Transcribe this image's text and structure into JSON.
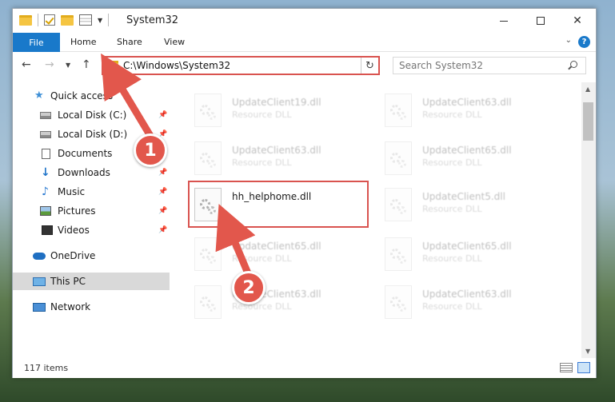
{
  "window": {
    "title": "System32",
    "controls": {
      "minimize": "",
      "maximize": "",
      "close": "✕"
    }
  },
  "ribbon": {
    "file_label": "File",
    "tabs": [
      "Home",
      "Share",
      "View"
    ],
    "expand": "⌄",
    "help": "?"
  },
  "navbar": {
    "back": "←",
    "forward": "→",
    "recent": "▼",
    "up": "↑",
    "address": "C:\\Windows\\System32",
    "refresh": "↻",
    "search_placeholder": "Search System32"
  },
  "sidebar": {
    "items": [
      {
        "label": "Quick access",
        "icon": "star-icon"
      },
      {
        "label": "Local Disk (C:)",
        "icon": "disk-icon",
        "pinned": "📌"
      },
      {
        "label": "Local Disk (D:)",
        "icon": "disk-icon",
        "pinned": "📌"
      },
      {
        "label": "Documents",
        "icon": "documents-icon",
        "pinned": "📌"
      },
      {
        "label": "Downloads",
        "icon": "downloads-icon",
        "pinned": "📌"
      },
      {
        "label": "Music",
        "icon": "music-icon",
        "pinned": "📌"
      },
      {
        "label": "Pictures",
        "icon": "pictures-icon",
        "pinned": "📌"
      },
      {
        "label": "Videos",
        "icon": "videos-icon",
        "pinned": "📌"
      },
      {
        "label": "OneDrive",
        "icon": "onedrive-icon"
      },
      {
        "label": "This PC",
        "icon": "this-pc-icon"
      },
      {
        "label": "Network",
        "icon": "network-icon"
      }
    ]
  },
  "files": [
    {
      "name": "UpdateClient19.dll",
      "type": "Resource DLL"
    },
    {
      "name": "UpdateClient63.dll",
      "type": "Resource DLL"
    },
    {
      "name": "UpdateClient63.dll",
      "type": "Resource DLL"
    },
    {
      "name": "UpdateClient65.dll",
      "type": "Resource DLL"
    },
    {
      "name": "hh_helphome.dll",
      "type": ""
    },
    {
      "name": "UpdateClient5.dll",
      "type": "Resource DLL"
    },
    {
      "name": "UpdateClient65.dll",
      "type": "Resource DLL"
    },
    {
      "name": "UpdateClient65.dll",
      "type": "Resource DLL"
    },
    {
      "name": "UpdateClient63.dll",
      "type": "Resource DLL"
    },
    {
      "name": "UpdateClient63.dll",
      "type": "Resource DLL"
    }
  ],
  "status": {
    "count": "117 items"
  },
  "scrollbar": {
    "up": "▲",
    "down": "▼"
  },
  "annotations": {
    "badge1": "1",
    "badge2": "2"
  },
  "colors": {
    "accent": "#1979ca",
    "annotation": "#e2574c"
  }
}
